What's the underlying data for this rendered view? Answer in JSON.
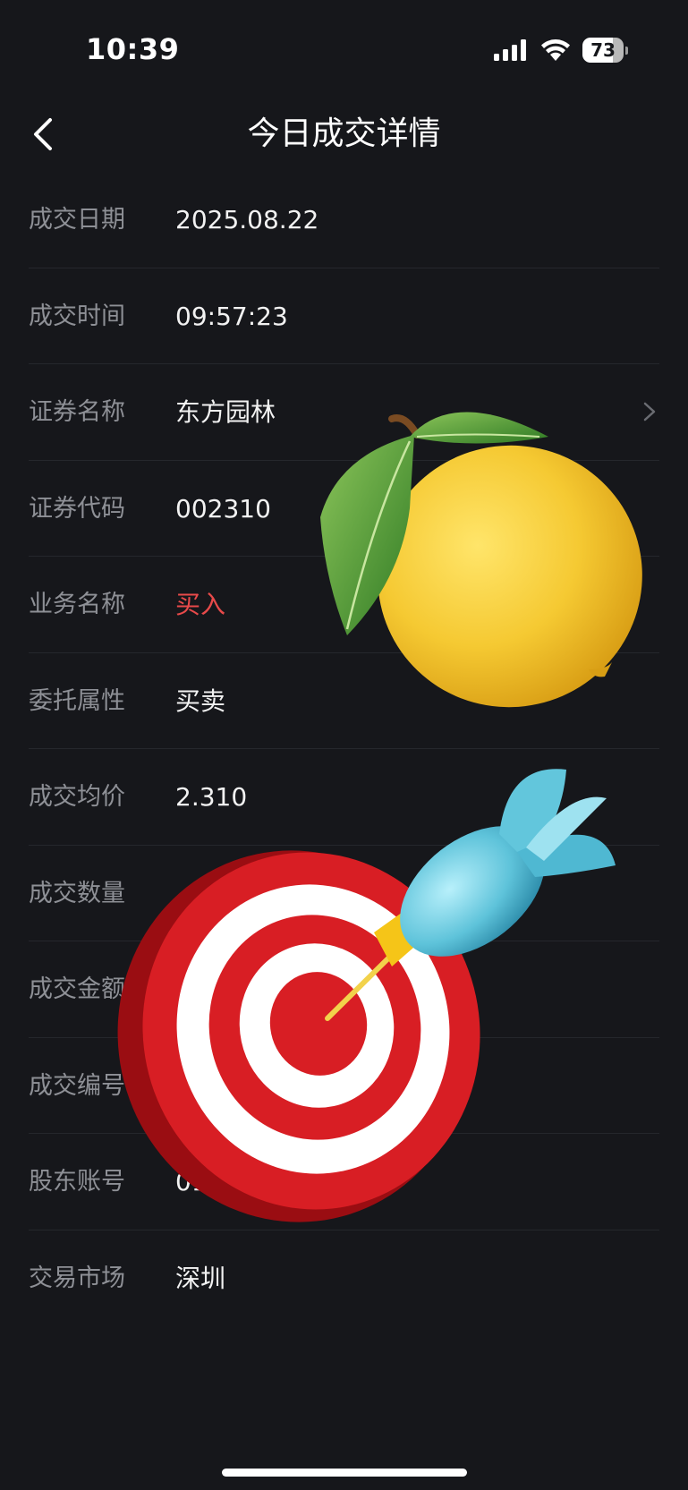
{
  "status_bar": {
    "time": "10:39",
    "battery": "73",
    "battery_level": 0.73
  },
  "nav": {
    "title": "今日成交详情"
  },
  "rows": [
    {
      "label": "成交日期",
      "value": "2025.08.22"
    },
    {
      "label": "成交时间",
      "value": "09:57:23"
    },
    {
      "label": "证券名称",
      "value": "东方园林"
    },
    {
      "label": "证券代码",
      "value": "002310"
    },
    {
      "label": "业务名称",
      "value": "买入"
    },
    {
      "label": "委托属性",
      "value": "买卖"
    },
    {
      "label": "成交均价",
      "value": "2.310"
    },
    {
      "label": "成交数量",
      "value": ""
    },
    {
      "label": "成交金额",
      "value": ""
    },
    {
      "label": "成交编号",
      "value": ""
    },
    {
      "label": "股东账号",
      "value": "01"
    },
    {
      "label": "交易市场",
      "value": "深圳"
    }
  ],
  "colors": {
    "background": "#16171b",
    "buy_red": "#e84a4a",
    "label_gray": "#8e9096",
    "divider": "#25272c"
  },
  "stickers": [
    "lemon-sticker",
    "dart-target-sticker"
  ]
}
